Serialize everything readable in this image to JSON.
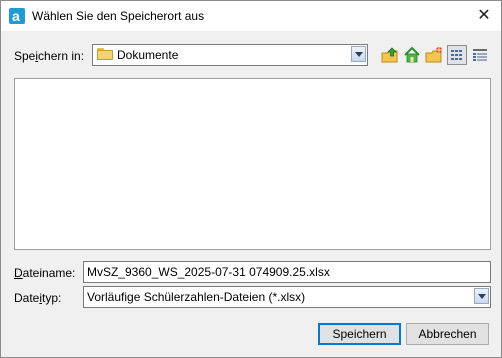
{
  "window": {
    "title": "Wählen Sie den Speicherort aus",
    "close_glyph": "✕"
  },
  "location": {
    "label": "Speichern in:",
    "label_parts": [
      "Spe",
      "i",
      "chern in:"
    ],
    "value": "Dokumente",
    "icon": "folder-icon"
  },
  "toolbar": {
    "items": [
      "up-one-level-icon",
      "home-icon",
      "new-folder-icon",
      "list-view-icon",
      "details-view-icon"
    ],
    "pressed": "list-view-icon"
  },
  "filename": {
    "label_parts": [
      "",
      "D",
      "ateiname:"
    ],
    "value": "MvSZ_9360_WS_2025-07-31 074909.25.xlsx"
  },
  "filetype": {
    "label_parts": [
      "Date",
      "i",
      "typ:"
    ],
    "value": "Vorläufige Schülerzahlen-Dateien (*.xlsx)"
  },
  "buttons": {
    "save": "Speichern",
    "cancel": "Abbrechen"
  },
  "colors": {
    "accent": "#0078d7",
    "app_icon": "#1f9ad6"
  }
}
